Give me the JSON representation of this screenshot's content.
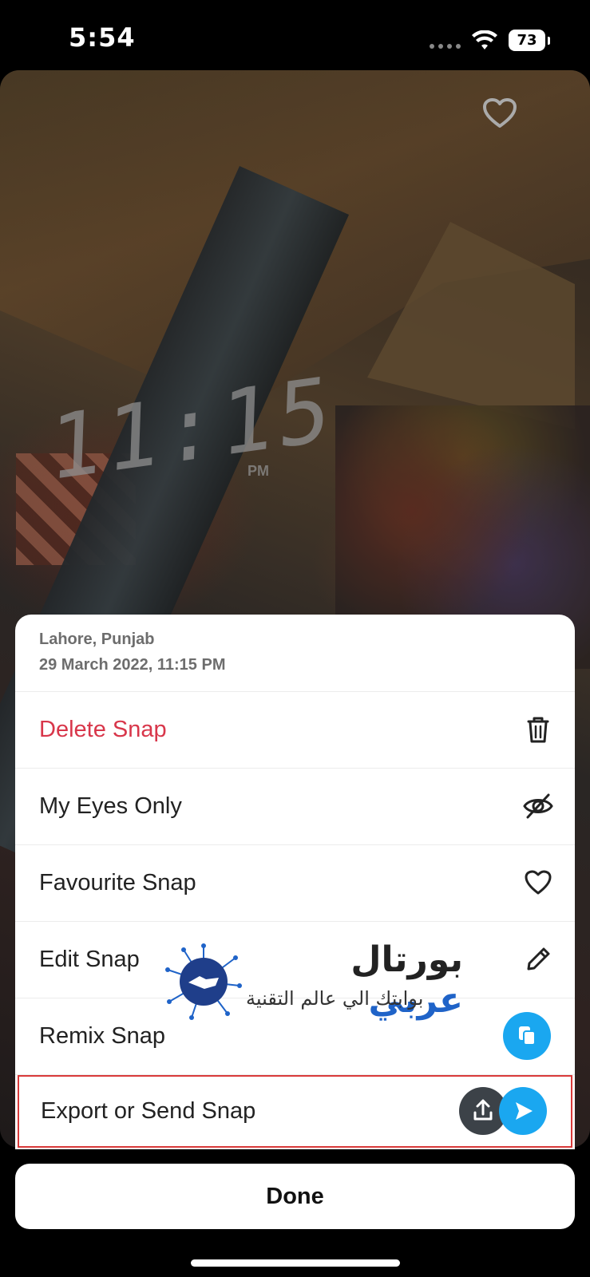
{
  "status_bar": {
    "time": "5:54",
    "battery": "73"
  },
  "photo": {
    "clock_digits": "11:15",
    "clock_suffix": "PM"
  },
  "sheet": {
    "location": "Lahore, Punjab",
    "datetime": "29 March 2022, 11:15 PM",
    "items": [
      {
        "label": "Delete Snap",
        "icon": "trash-icon",
        "color": "#d8364a"
      },
      {
        "label": "My Eyes Only",
        "icon": "eye-slash-icon"
      },
      {
        "label": "Favourite Snap",
        "icon": "heart-icon"
      },
      {
        "label": "Edit Snap",
        "icon": "pencil-icon"
      },
      {
        "label": "Remix Snap",
        "icon": "remix-icon"
      },
      {
        "label": "Export or Send Snap",
        "icon": "export-send-icons"
      }
    ]
  },
  "watermark": {
    "title_part1": "عربي",
    "title_part2": "بورتال",
    "subtitle": "بوابتك الي عالم التقنية"
  },
  "done_label": "Done",
  "colors": {
    "accent": "#1aa7f0",
    "danger": "#d8364a",
    "highlight": "#d93a3a"
  }
}
